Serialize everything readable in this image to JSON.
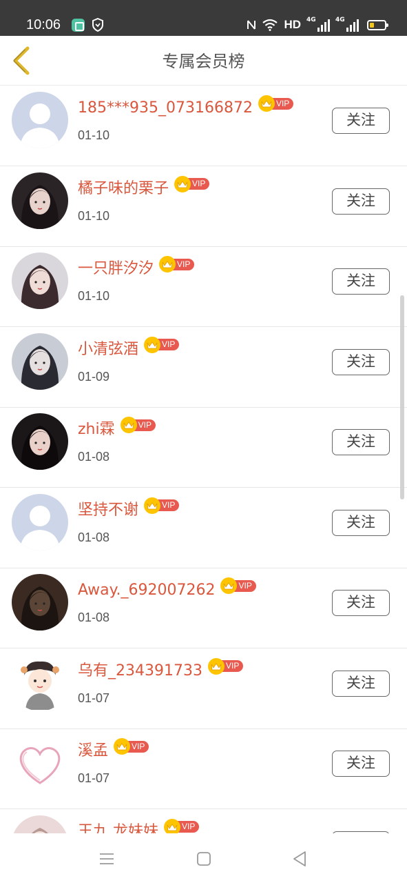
{
  "status_bar": {
    "time": "10:06",
    "network_label": "HD",
    "signal_1_tag": "4G",
    "signal_2_tag": "4G",
    "icons": [
      "app-icon",
      "shield-icon",
      "nfc-icon",
      "wifi-icon",
      "signal-icon",
      "signal-icon",
      "battery-icon"
    ]
  },
  "header": {
    "title": "专属会员榜",
    "back_icon": "chevron-left-icon",
    "accent_color": "#e0b82c"
  },
  "list": {
    "follow_label": "关注",
    "vip_label": "VIP",
    "name_color": "#d9573d",
    "items": [
      {
        "name": "185***935_073166872",
        "date": "01-10"
      },
      {
        "name": "橘子味的栗子",
        "date": "01-10"
      },
      {
        "name": "一只胖汐汐",
        "date": "01-10"
      },
      {
        "name": "小清弦酒",
        "date": "01-09"
      },
      {
        "name": "zhi霖",
        "date": "01-08"
      },
      {
        "name": "坚持不谢",
        "date": "01-08"
      },
      {
        "name": "Away._692007262",
        "date": "01-08"
      },
      {
        "name": "乌有_234391733",
        "date": "01-07"
      },
      {
        "name": "溪孟",
        "date": "01-07"
      },
      {
        "name": "王九 龙妹妹",
        "date": ""
      }
    ]
  },
  "bottom_nav": {
    "icons": [
      "menu-icon",
      "home-square-icon",
      "back-triangle-icon"
    ]
  }
}
